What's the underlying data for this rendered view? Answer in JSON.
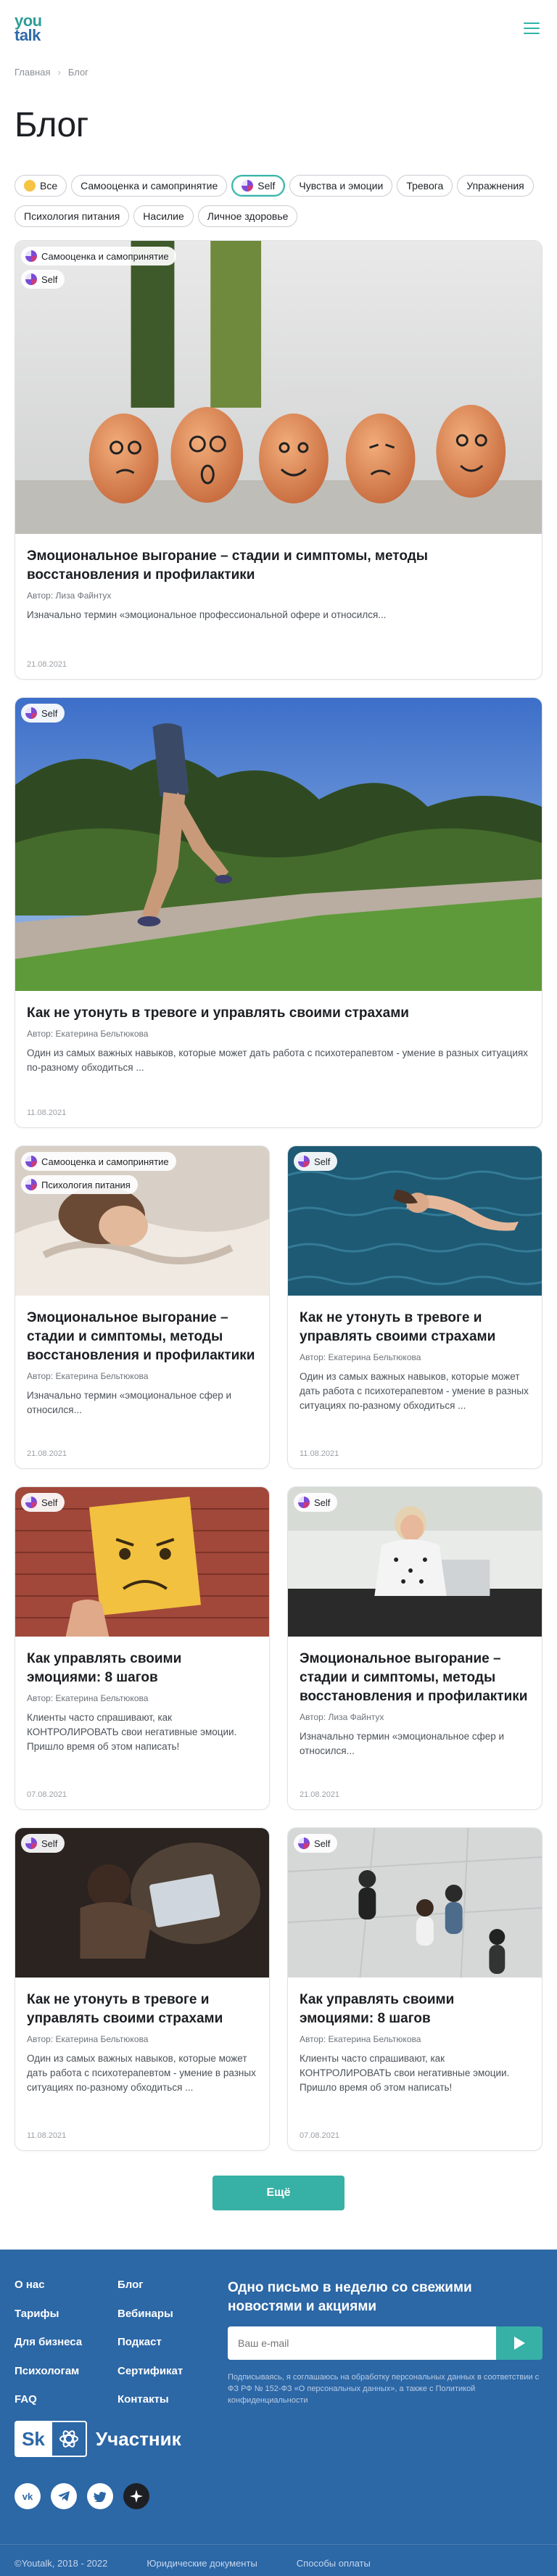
{
  "header": {
    "logo_top": "you",
    "logo_bottom": "talk"
  },
  "breadcrumb": {
    "home": "Главная",
    "current": "Блог"
  },
  "page_title": "Блог",
  "tags": [
    {
      "label": "Все",
      "icon": "smile-icon",
      "active": false
    },
    {
      "label": "Самооценка и самопринятие",
      "icon": "",
      "active": false
    },
    {
      "label": "Self",
      "icon": "self-icon",
      "active": true
    },
    {
      "label": "Чувства и эмоции",
      "icon": "",
      "active": false
    },
    {
      "label": "Тревога",
      "icon": "",
      "active": false
    },
    {
      "label": "Упражнения",
      "icon": "",
      "active": false
    },
    {
      "label": "Психология питания",
      "icon": "",
      "active": false
    },
    {
      "label": "Насилие",
      "icon": "",
      "active": false
    },
    {
      "label": "Личное здоровье",
      "icon": "",
      "active": false
    }
  ],
  "cards": [
    {
      "chips": [
        "Самооценка и самопринятие",
        "Self"
      ],
      "title": "Эмоциональное выгорание – стадии и симптомы, методы восстановления и профилактики",
      "author": "Автор: Лиза Файнтух",
      "excerpt": "Изначально термин «эмоциональное профессиональной офере и относился...",
      "date": "21.08.2021"
    },
    {
      "chips": [
        "Self"
      ],
      "title": "Как не утонуть в тревоге и управлять своими страхами",
      "author": "Автор: Екатерина Бельтюкова",
      "excerpt": "Один из самых важных навыков, которые может дать работа с психотерапевтом - умение в разных ситуациях по-разному обходиться ...",
      "date": "11.08.2021"
    },
    {
      "chips": [
        "Самооценка и самопринятие",
        "Психология питания"
      ],
      "title": "Эмоциональное выгорание – стадии и симптомы, методы восстановления и профилактики",
      "author": "Автор: Екатерина Бельтюкова",
      "excerpt": "Изначально термин «эмоциональное сфер и относился...",
      "date": "21.08.2021"
    },
    {
      "chips": [
        "Self"
      ],
      "title": "Как не утонуть в тревоге и управлять своими страхами",
      "author": "Автор: Екатерина Бельтюкова",
      "excerpt": "Один из самых важных навыков, которые может дать работа с психотерапевтом - умение в разных ситуациях по-разному обходиться ...",
      "date": "11.08.2021"
    },
    {
      "chips": [
        "Self"
      ],
      "title": "Как управлять своими эмоциями: 8 шагов",
      "author": "Автор: Екатерина Бельтюкова",
      "excerpt": "Клиенты часто спрашивают, как КОНТРОЛИРОВАТЬ свои негативные эмоции. Пришло время об этом написать!",
      "date": "07.08.2021"
    },
    {
      "chips": [
        "Self"
      ],
      "title": "Эмоциональное выгорание – стадии и симптомы, методы восстановления и профилактики",
      "author": "Автор: Лиза Файнтух",
      "excerpt": "Изначально термин «эмоциональное сфер и относился...",
      "date": "21.08.2021"
    },
    {
      "chips": [
        "Self"
      ],
      "title": "Как не утонуть в тревоге и управлять своими страхами",
      "author": "Автор: Екатерина Бельтюкова",
      "excerpt": "Один из самых важных навыков, которые может дать работа с психотерапевтом - умение в разных ситуациях по-разному обходиться ...",
      "date": "11.08.2021"
    },
    {
      "chips": [
        "Self"
      ],
      "title": "Как управлять своими эмоциями: 8 шагов",
      "author": "Автор: Екатерина Бельтюкова",
      "excerpt": "Клиенты часто спрашивают, как КОНТРОЛИРОВАТЬ свои негативные эмоции. Пришло время об этом написать!",
      "date": "07.08.2021"
    }
  ],
  "more_button": "Ещё",
  "footer": {
    "links": [
      "О нас",
      "Блог",
      "Тарифы",
      "Вебинары",
      "Для бизнеса",
      "Подкаст",
      "Психологам",
      "Сертификат",
      "FAQ",
      "Контакты"
    ],
    "subscribe_title": "Одно письмо в неделю со свежими новостями и акциями",
    "email_placeholder": "Ваш e-mail",
    "note": "Подписываясь, я соглашаюсь на обработку персональных данных в соответствии с ФЗ РФ № 152-ФЗ «О персональных данных», а также с Политикой конфиденциальности",
    "sk_badge": "Sk",
    "sk_label": "Участник",
    "socials": [
      "vk-icon",
      "telegram-icon",
      "twitter-icon",
      "star-icon"
    ],
    "copyright": "©Youtalk, 2018 - 2022",
    "legal": "Юридические документы",
    "payment": "Способы оплаты"
  },
  "colors": {
    "accent": "#37b0a5",
    "footer": "#2c67a6",
    "brand_blue": "#2f6ba8"
  }
}
